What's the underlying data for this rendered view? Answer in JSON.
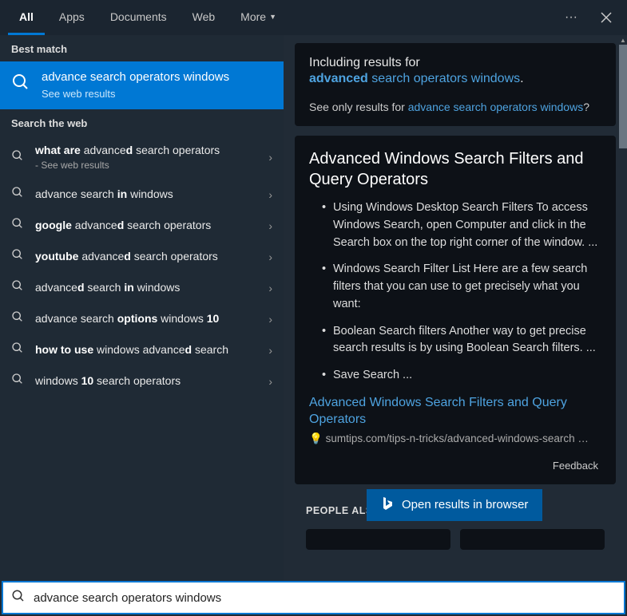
{
  "header": {
    "tabs": [
      "All",
      "Apps",
      "Documents",
      "Web",
      "More"
    ],
    "active_tab": 0
  },
  "left": {
    "best_match_title": "Best match",
    "best_match": {
      "title": "advance search operators windows",
      "subtitle": "See web results"
    },
    "search_web_title": "Search the web",
    "items": [
      {
        "html": "<b>what are</b> advance<b>d</b> search operators",
        "sub": "- See web results"
      },
      {
        "html": "advance search <b>in</b> windows"
      },
      {
        "html": "<b>google</b> advance<b>d</b> search operators"
      },
      {
        "html": "<b>youtube</b> advance<b>d</b> search operators"
      },
      {
        "html": "advance<b>d</b> search <b>in</b> windows"
      },
      {
        "html": "advance search <b>options</b> windows <b>10</b>"
      },
      {
        "html": "<b>how to use</b> windows advance<b>d</b> search"
      },
      {
        "html": "windows <b>10</b> search operators"
      }
    ]
  },
  "right": {
    "including_label": "Including results for",
    "corrected_bold": "advanced",
    "corrected_rest": " search operators windows",
    "only_label": "See only results for ",
    "only_link": "advance search operators windows",
    "card2_title": "Advanced Windows Search Filters and Query Operators",
    "bullets": [
      "Using Windows Desktop Search Filters To access Windows Search, open Computer and click in the Search box on the top right corner of the window. ...",
      "Windows Search Filter List Here are a few search filters that you can use to get precisely what you want:",
      "Boolean Search filters Another way to get precise search results is by using Boolean Search filters. ...",
      "Save Search ..."
    ],
    "result_link": "Advanced Windows Search Filters and Query Operators",
    "result_url": "sumtips.com/tips-n-tricks/advanced-windows-search …",
    "feedback": "Feedback",
    "people_also": "PEOPLE ALSO",
    "open_browser": "Open results in browser"
  },
  "search_input": "advance search operators windows"
}
